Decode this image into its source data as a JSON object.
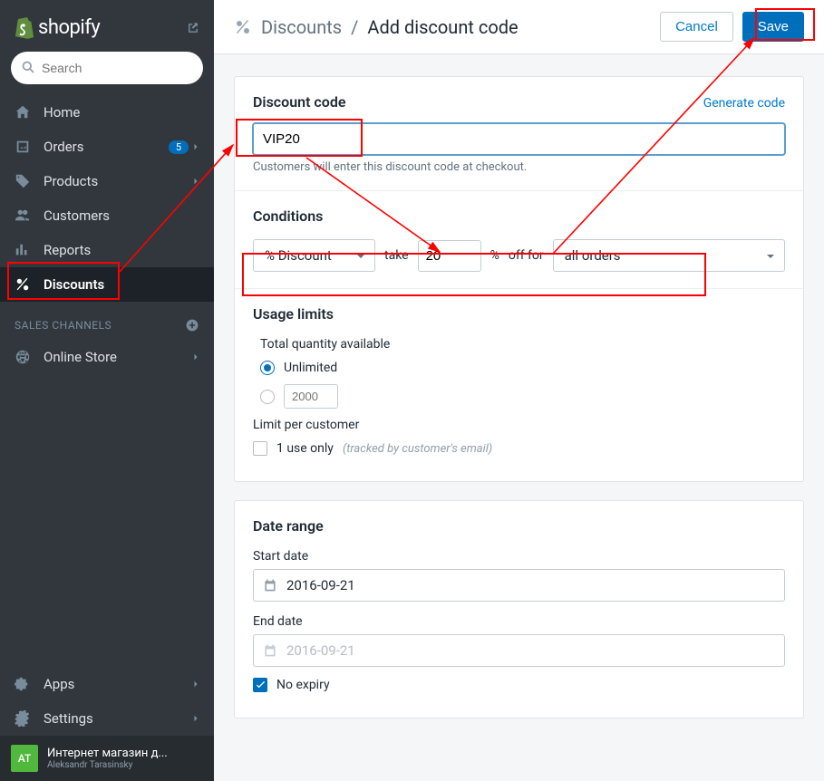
{
  "brand": "shopify",
  "search": {
    "placeholder": "Search"
  },
  "nav": {
    "home": "Home",
    "orders": "Orders",
    "orders_badge": "5",
    "products": "Products",
    "customers": "Customers",
    "reports": "Reports",
    "discounts": "Discounts"
  },
  "sales_channels": {
    "header": "SALES CHANNELS",
    "online_store": "Online Store"
  },
  "bottom_nav": {
    "apps": "Apps",
    "settings": "Settings"
  },
  "user": {
    "initials": "AT",
    "store": "Интернет магазин д...",
    "name": "Aleksandr Tarasinsky"
  },
  "breadcrumb": {
    "parent": "Discounts",
    "slash": "/",
    "current": "Add discount code"
  },
  "actions": {
    "cancel": "Cancel",
    "save": "Save"
  },
  "discount_code": {
    "title": "Discount code",
    "generate": "Generate code",
    "value": "VIP20",
    "help": "Customers will enter this discount code at checkout."
  },
  "conditions": {
    "title": "Conditions",
    "type": "% Discount",
    "take": "take",
    "amount": "20",
    "unit": "%",
    "off_for": "off for",
    "target": "all orders"
  },
  "usage": {
    "title": "Usage limits",
    "total_label": "Total quantity available",
    "unlimited": "Unlimited",
    "qty_placeholder": "2000",
    "limit_label": "Limit per customer",
    "one_use": "1 use only",
    "one_use_hint": "(tracked by customer's email)"
  },
  "dates": {
    "title": "Date range",
    "start_label": "Start date",
    "start_value": "2016-09-21",
    "end_label": "End date",
    "end_placeholder": "2016-09-21",
    "no_expiry": "No expiry"
  }
}
